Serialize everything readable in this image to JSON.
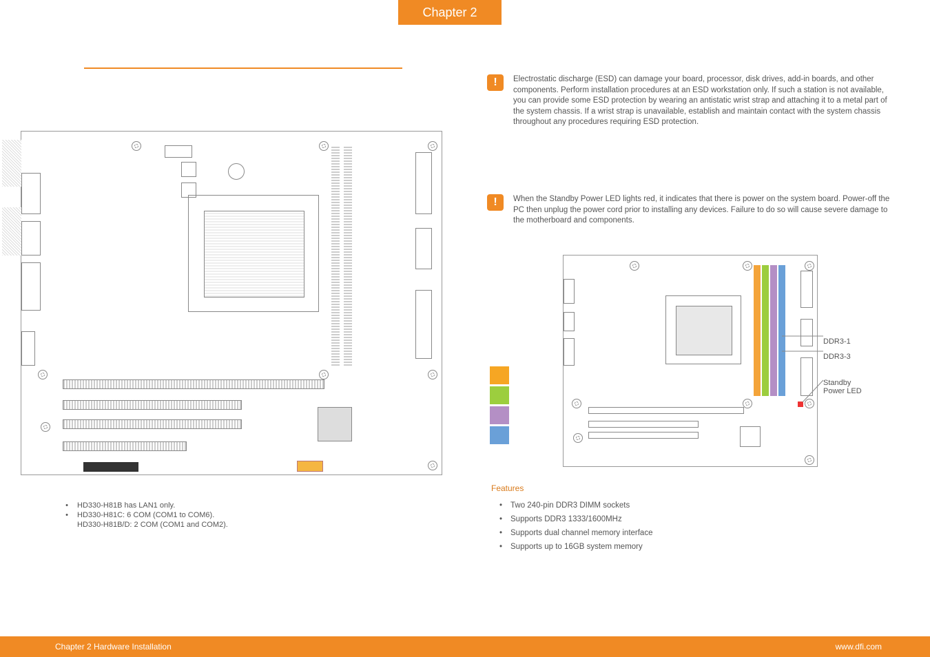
{
  "chapter_tab": "Chapter 2",
  "left": {
    "footnotes": [
      "HD330-H81B has LAN1 only.",
      "HD330-H81C: 6 COM (COM1 to COM6).",
      "HD330-H81B/D: 2 COM (COM1 and COM2)."
    ]
  },
  "right": {
    "important1": "Electrostatic discharge (ESD) can damage your board, processor, disk drives, add-in boards, and other components. Perform installation procedures at an ESD workstation only. If such a station is not available, you can provide some ESD protection by wearing an antistatic wrist strap and attaching it to a metal part of the system chassis. If a wrist strap is unavailable, establish and maintain contact with the system chassis throughout any procedures requiring ESD protection.",
    "important2": "When the Standby Power LED lights red, it indicates that there is power on the system board. Power-off the PC then unplug the power cord prior to installing any devices. Failure to do so will cause severe damage to the motherboard and components.",
    "labels": {
      "ddr1": "DDR3-1",
      "ddr3": "DDR3-3",
      "standby_l1": "Standby",
      "standby_l2": "Power LED"
    },
    "features_heading": "Features",
    "features": [
      "Two 240-pin DDR3 DIMM sockets",
      "Supports DDR3 1333/1600MHz",
      "Supports dual channel memory interface",
      "Supports up to 16GB system memory"
    ]
  },
  "footer": {
    "left": "Chapter 2 Hardware Installation",
    "right": "www.dfi.com"
  }
}
